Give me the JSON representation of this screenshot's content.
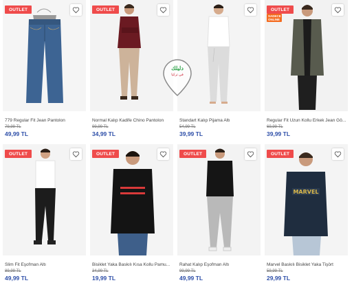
{
  "products": [
    {
      "name": "779 Regular Fit Jean Pantolon",
      "old_price": "79,99 TL",
      "price": "49,99 TL",
      "badge": "OUTLET",
      "promo": "",
      "figure": "jeans-flat"
    },
    {
      "name": "Normal Kalıp Kadife Chino Pantolon",
      "old_price": "99,99 TL",
      "price": "34,99 TL",
      "badge": "OUTLET",
      "promo": "",
      "figure": "man-beige-pants"
    },
    {
      "name": "Standart Kalıp Pijama Altı",
      "old_price": "54,99 TL",
      "price": "39,99 TL",
      "badge": "",
      "promo": "",
      "figure": "man-grey-pajama"
    },
    {
      "name": "Regular Fit Uzun Kollu Erkek Jean Gö...",
      "old_price": "69,99 TL",
      "price": "39,99 TL",
      "badge": "OUTLET",
      "promo": "SADECE ONLINE",
      "figure": "man-khaki-shirt"
    },
    {
      "name": "Slim Fit Eşofman Altı",
      "old_price": "89,99 TL",
      "price": "49,99 TL",
      "badge": "OUTLET",
      "promo": "",
      "figure": "man-black-jogger"
    },
    {
      "name": "Bisiklet Yaka Baskılı Kısa Kollu Pamu...",
      "old_price": "34,99 TL",
      "price": "19,99 TL",
      "badge": "OUTLET",
      "promo": "",
      "figure": "man-black-tee-stripes"
    },
    {
      "name": "Rahat Kalıp Eşofman Altı",
      "old_price": "99,99 TL",
      "price": "49,99 TL",
      "badge": "OUTLET",
      "promo": "",
      "figure": "man-hoodie-grey-jogger"
    },
    {
      "name": "Marvel Baskılı Bisiklet Yaka Tişört",
      "old_price": "59,99 TL",
      "price": "29,99 TL",
      "badge": "OUTLET",
      "promo": "",
      "figure": "man-marvel-tee"
    }
  ],
  "watermark": {
    "text": "دليلك",
    "sub": "في تركيا"
  },
  "icons": {
    "favorite": "heart-icon"
  },
  "colors": {
    "badge": "#ef4b4b",
    "price": "#2d4ea8",
    "promo": "#f46b1f"
  }
}
